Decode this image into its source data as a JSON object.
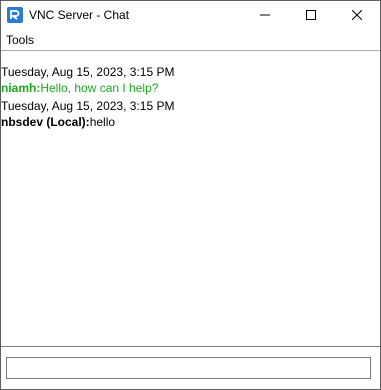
{
  "window": {
    "title": "VNC Server - Chat"
  },
  "menu": {
    "items": [
      {
        "label": "Tools"
      }
    ]
  },
  "chat": {
    "messages": [
      {
        "timestamp": "Tuesday, Aug 15, 2023, 3:15 PM",
        "sender": "niamh:",
        "text": "Hello, how can I help?",
        "color": "#1aaa1a"
      },
      {
        "timestamp": "Tuesday, Aug 15, 2023, 3:15 PM",
        "sender": "nbsdev (Local):",
        "text": "hello",
        "color": "#000000"
      }
    ]
  },
  "input": {
    "value": "",
    "placeholder": ""
  },
  "icons": {
    "app": "vnc-logo-icon",
    "minimize": "minimize-icon",
    "maximize": "maximize-icon",
    "close": "close-icon"
  },
  "colors": {
    "remote_sender": "#1aaa1a",
    "local_sender": "#000000",
    "vnc_brand": "#2b7bd6"
  }
}
